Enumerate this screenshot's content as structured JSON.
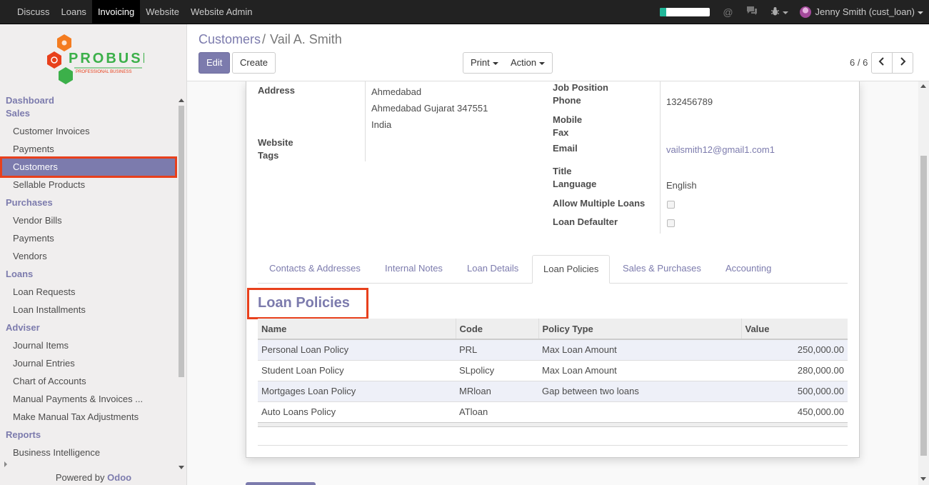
{
  "topbar": {
    "menu": [
      "Discuss",
      "Loans",
      "Invoicing",
      "Website",
      "Website Admin"
    ],
    "active_index": 2,
    "progress_fraction": 0.12,
    "user": "Jenny Smith (cust_loan)"
  },
  "sidebar": {
    "logo_text": "PROBUSE",
    "logo_subtext": "PROFESSIONAL BUSINESS",
    "dashboard": "Dashboard",
    "sales": {
      "header": "Sales",
      "items": [
        "Customer Invoices",
        "Payments",
        "Customers",
        "Sellable Products"
      ]
    },
    "purchases": {
      "header": "Purchases",
      "items": [
        "Vendor Bills",
        "Payments",
        "Vendors"
      ]
    },
    "loans": {
      "header": "Loans",
      "items": [
        "Loan Requests",
        "Loan Installments"
      ]
    },
    "adviser": {
      "header": "Adviser",
      "items": [
        "Journal Items",
        "Journal Entries",
        "Chart of Accounts",
        "Manual Payments & Invoices ...",
        "Make Manual Tax Adjustments"
      ]
    },
    "reports": {
      "header": "Reports",
      "items": [
        "Business Intelligence"
      ]
    },
    "powered_by": "Powered by",
    "powered_brand": "Odoo"
  },
  "control": {
    "breadcrumb_parent": "Customers",
    "breadcrumb_sep": "/",
    "breadcrumb_current": "Vail A. Smith",
    "edit_label": "Edit",
    "create_label": "Create",
    "print_label": "Print",
    "action_label": "Action",
    "pager": "6 / 6"
  },
  "form": {
    "address_label": "Address",
    "address_lines": [
      "Ahmedabad",
      "Ahmedabad Gujarat 347551",
      "India"
    ],
    "website_label": "Website",
    "tags_label": "Tags",
    "job_position_label": "Job Position",
    "phone_label": "Phone",
    "phone_value": "132456789",
    "mobile_label": "Mobile",
    "fax_label": "Fax",
    "email_label": "Email",
    "email_value": "vailsmith12@gmail1.com1",
    "title_label": "Title",
    "language_label": "Language",
    "language_value": "English",
    "allow_multiple_label": "Allow Multiple Loans",
    "defaulter_label": "Loan Defaulter"
  },
  "tabs": [
    "Contacts & Addresses",
    "Internal Notes",
    "Loan Details",
    "Loan Policies",
    "Sales & Purchases",
    "Accounting"
  ],
  "active_tab": 3,
  "policies": {
    "title": "Loan Policies",
    "columns": [
      "Name",
      "Code",
      "Policy Type",
      "Value"
    ],
    "rows": [
      [
        "Personal Loan Policy",
        "PRL",
        "Max Loan Amount",
        "250,000.00"
      ],
      [
        "Student Loan Policy",
        "SLpolicy",
        "Max Loan Amount",
        "280,000.00"
      ],
      [
        "Mortgages Loan Policy",
        "MRloan",
        "Gap between two loans",
        "500,000.00"
      ],
      [
        "Auto Loans Policy",
        "ATloan",
        "",
        "450,000.00"
      ]
    ]
  },
  "colors": {
    "accent": "#7c7bad",
    "highlight": "#e8401c",
    "topbar": "#222222"
  }
}
